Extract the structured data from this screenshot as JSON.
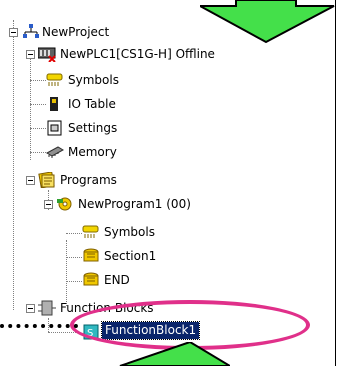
{
  "tree": {
    "project": "NewProject",
    "plc": "NewPLC1[CS1G-H] Offline",
    "plc_items": [
      {
        "key": "symbols",
        "label": "Symbols",
        "icon": "symbols-icon"
      },
      {
        "key": "io",
        "label": "IO Table",
        "icon": "io-table-icon"
      },
      {
        "key": "settings",
        "label": "Settings",
        "icon": "settings-icon"
      },
      {
        "key": "memory",
        "label": "Memory",
        "icon": "memory-icon"
      }
    ],
    "programs": "Programs",
    "program1": "NewProgram1 (00)",
    "program_items": [
      {
        "key": "psymbols",
        "label": "Symbols",
        "icon": "symbols-icon"
      },
      {
        "key": "section1",
        "label": "Section1",
        "icon": "section-icon"
      },
      {
        "key": "end",
        "label": "END",
        "icon": "section-icon"
      }
    ],
    "function_blocks": "Function Blocks",
    "function_block1": "FunctionBlock1"
  },
  "colors": {
    "arrow_green": "#44e04a",
    "highlight_pink": "#e0308a",
    "selection_blue": "#0a246a"
  }
}
